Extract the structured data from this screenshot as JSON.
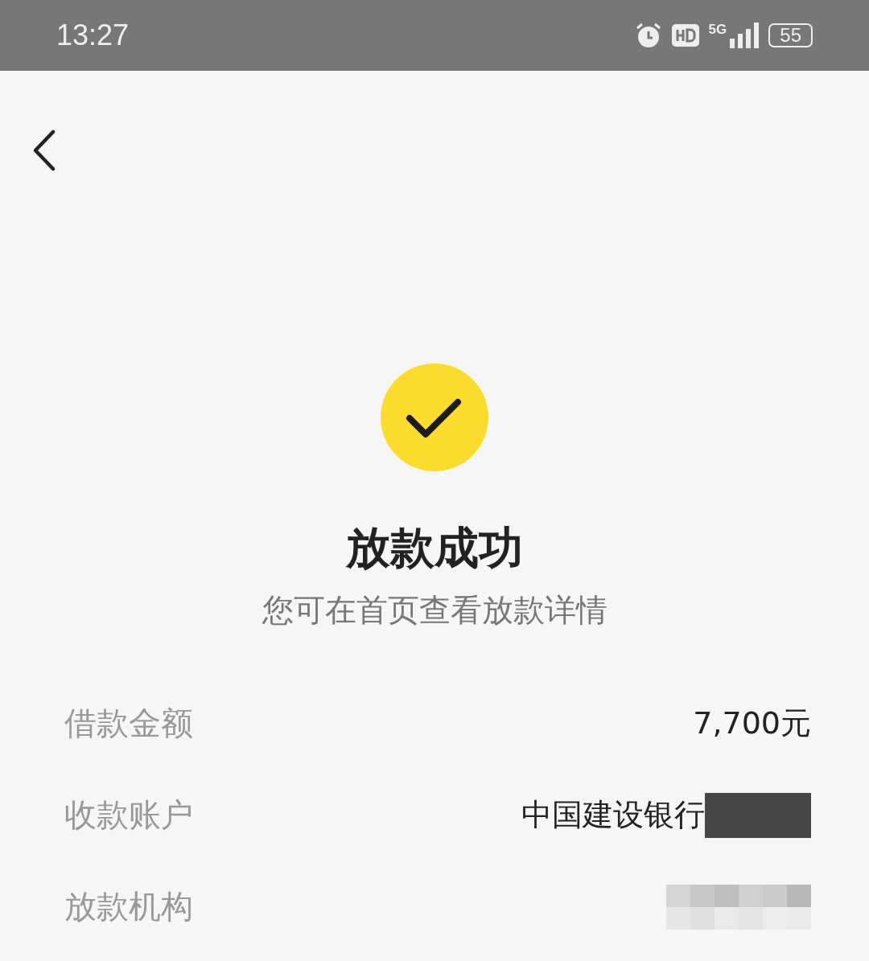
{
  "status_bar": {
    "time": "13:27",
    "network": "5G",
    "battery": "55"
  },
  "title": "放款成功",
  "subtitle": "您可在首页查看放款详情",
  "rows": [
    {
      "label": "借款金额",
      "value": "7,700元"
    },
    {
      "label": "收款账户",
      "value": "中国建设银行",
      "masked": true
    },
    {
      "label": "放款机构",
      "blurred": true
    }
  ]
}
